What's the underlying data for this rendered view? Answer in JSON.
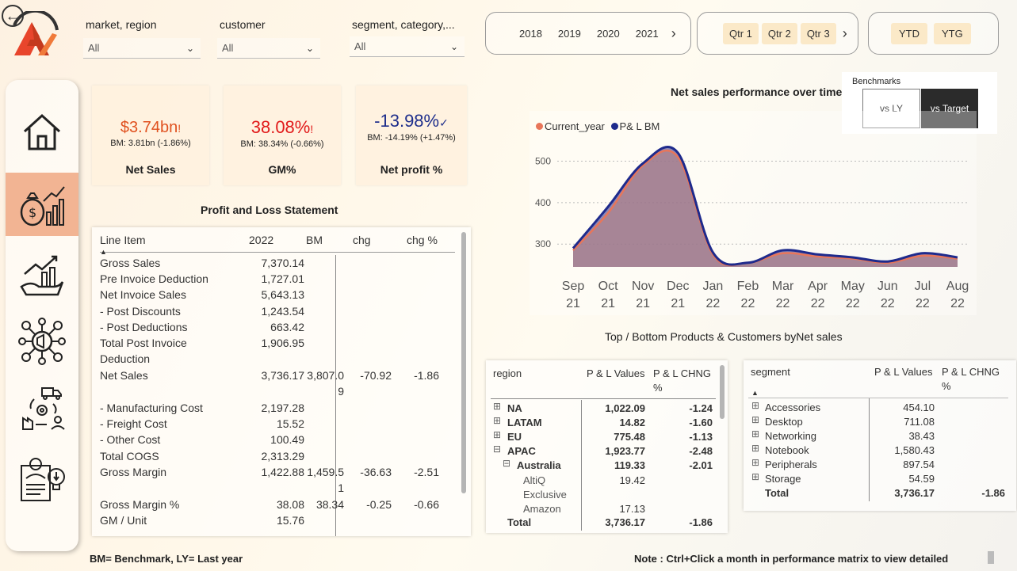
{
  "slicers": {
    "market_label": "market, region",
    "market_value": "All",
    "customer_label": "customer",
    "customer_value": "All",
    "segment_label": "segment, category,...",
    "segment_value": "All"
  },
  "years": [
    "2018",
    "2019",
    "2020",
    "2021"
  ],
  "quarters": [
    "Qtr 1",
    "Qtr 2",
    "Qtr 3"
  ],
  "ytd": [
    "YTD",
    "YTG"
  ],
  "kpis": [
    {
      "value": "$3.74bn",
      "flag": "!",
      "bm": "BM: 3.81bn (-1.86%)",
      "title": "Net Sales",
      "color": "#e0511f"
    },
    {
      "value": "38.08%",
      "flag": "!",
      "bm": "BM: 38.34% (-0.66%)",
      "title": "GM%",
      "color": "#e11a1a"
    },
    {
      "value": "-13.98%",
      "flag": "✓",
      "bm": "BM: -14.19% (+1.47%)",
      "title": "Net profit %",
      "color": "#1f2f8c"
    }
  ],
  "pl": {
    "title": "Profit and Loss Statement",
    "headers": [
      "Line Item",
      "2022",
      "BM",
      "chg",
      "chg %"
    ],
    "rows": [
      {
        "item": "Gross Sales",
        "v": "7,370.14",
        "bm": "",
        "chg": "",
        "pct": ""
      },
      {
        "item": "Pre Invoice Deduction",
        "v": "1,727.01",
        "bm": "",
        "chg": "",
        "pct": ""
      },
      {
        "item": "Net Invoice Sales",
        "v": "5,643.13",
        "bm": "",
        "chg": "",
        "pct": ""
      },
      {
        "item": "- Post Discounts",
        "v": "1,243.54",
        "bm": "",
        "chg": "",
        "pct": ""
      },
      {
        "item": "- Post Deductions",
        "v": "663.42",
        "bm": "",
        "chg": "",
        "pct": ""
      },
      {
        "item": "Total Post Invoice",
        "item2": "Deduction",
        "v": "1,906.95",
        "bm": "",
        "chg": "",
        "pct": ""
      },
      {
        "item": "Net Sales",
        "v": "3,736.17",
        "bm": "3,807.0",
        "bm2": "9",
        "chg": "-70.92",
        "pct": "-1.86"
      },
      {
        "item": "- Manufacturing Cost",
        "v": "2,197.28",
        "bm": "",
        "chg": "",
        "pct": ""
      },
      {
        "item": "- Freight Cost",
        "v": "15.52",
        "bm": "",
        "chg": "",
        "pct": ""
      },
      {
        "item": "- Other Cost",
        "v": "100.49",
        "bm": "",
        "chg": "",
        "pct": ""
      },
      {
        "item": "Total COGS",
        "v": "2,313.29",
        "bm": "",
        "chg": "",
        "pct": ""
      },
      {
        "item": "Gross Margin",
        "v": "1,422.88",
        "bm": "1,459.5",
        "bm2": "1",
        "chg": "-36.63",
        "pct": "-2.51"
      },
      {
        "item": "Gross Margin %",
        "v": "38.08",
        "bm": "38.34",
        "chg": "-0.25",
        "pct": "-0.66"
      },
      {
        "item": "GM / Unit",
        "v": "15.76",
        "bm": "",
        "chg": "",
        "pct": ""
      }
    ]
  },
  "bench": {
    "title": "Benchmarks",
    "opt1": "vs LY",
    "opt2": "vs Target"
  },
  "chart": {
    "title": "Net sales performance over time",
    "legend": [
      "Current_year",
      "P& L  BM"
    ]
  },
  "chart_data": {
    "type": "area",
    "x": [
      "Sep 21",
      "Oct 21",
      "Nov 21",
      "Dec 21",
      "Jan 22",
      "Feb 22",
      "Mar 22",
      "Apr 22",
      "May 22",
      "Jun 22",
      "Jul 22",
      "Aug 22"
    ],
    "x_top": [
      "Sep",
      "Oct",
      "Nov",
      "Dec",
      "Jan",
      "Feb",
      "Mar",
      "Apr",
      "May",
      "Jun",
      "Jul",
      "Aug"
    ],
    "x_bottom": [
      "21",
      "21",
      "21",
      "21",
      "22",
      "22",
      "22",
      "22",
      "22",
      "22",
      "22",
      "22"
    ],
    "yticks": [
      300,
      400,
      500
    ],
    "ylim": [
      245,
      545
    ],
    "series": [
      {
        "name": "Current_year",
        "color": "#e8765a",
        "values": [
          285,
          375,
          490,
          510,
          275,
          255,
          278,
          270,
          265,
          255,
          272,
          265
        ]
      },
      {
        "name": "P& L  BM",
        "color": "#1e2a8c",
        "values": [
          290,
          390,
          495,
          520,
          280,
          255,
          285,
          275,
          268,
          258,
          278,
          268
        ]
      }
    ]
  },
  "topbottom_title": "Top / Bottom Products & Customers byNet sales",
  "region_matrix": {
    "headers": [
      "region",
      "P & L Values",
      "P & L CHNG",
      "%"
    ],
    "rows": [
      {
        "exp": "⊞",
        "name": "NA",
        "v": "1,022.09",
        "c": "-1.24",
        "lvl": 0,
        "bold": true
      },
      {
        "exp": "⊞",
        "name": "LATAM",
        "v": "14.82",
        "c": "-1.60",
        "lvl": 0,
        "bold": true
      },
      {
        "exp": "⊞",
        "name": "EU",
        "v": "775.48",
        "c": "-1.13",
        "lvl": 0,
        "bold": true
      },
      {
        "exp": "⊟",
        "name": "APAC",
        "v": "1,923.77",
        "c": "-2.48",
        "lvl": 0,
        "bold": true
      },
      {
        "exp": "⊟",
        "name": "Australia",
        "v": "119.33",
        "c": "-2.01",
        "lvl": 1,
        "bold": true
      },
      {
        "exp": "",
        "name": "AltiQ",
        "v": "19.42",
        "c": "",
        "lvl": 2,
        "bold": false
      },
      {
        "exp": "",
        "name": "Exclusive",
        "v": "",
        "c": "",
        "lvl": 2,
        "bold": false
      },
      {
        "exp": "",
        "name": "Amazon",
        "v": "17.13",
        "c": "",
        "lvl": 2,
        "bold": false
      },
      {
        "exp": "",
        "name": "Total",
        "v": "3,736.17",
        "c": "-1.86",
        "lvl": 0,
        "bold": true
      }
    ]
  },
  "segment_matrix": {
    "headers": [
      "segment",
      "P & L Values",
      "P & L CHNG",
      "%"
    ],
    "rows": [
      {
        "exp": "⊞",
        "name": "Accessories",
        "v": "454.10",
        "c": "",
        "bold": false
      },
      {
        "exp": "⊞",
        "name": "Desktop",
        "v": "711.08",
        "c": "",
        "bold": false
      },
      {
        "exp": "⊞",
        "name": "Networking",
        "v": "38.43",
        "c": "",
        "bold": false
      },
      {
        "exp": "⊞",
        "name": "Notebook",
        "v": "1,580.43",
        "c": "",
        "bold": false
      },
      {
        "exp": "⊞",
        "name": "Peripherals",
        "v": "897.54",
        "c": "",
        "bold": false
      },
      {
        "exp": "⊞",
        "name": "Storage",
        "v": "54.59",
        "c": "",
        "bold": false
      },
      {
        "exp": "",
        "name": "Total",
        "v": "3,736.17",
        "c": "-1.86",
        "bold": true
      }
    ]
  },
  "footer": {
    "legend": "BM= Benchmark, LY= Last year",
    "note": "Note : Ctrl+Click a month in performance matrix to view detailed"
  }
}
